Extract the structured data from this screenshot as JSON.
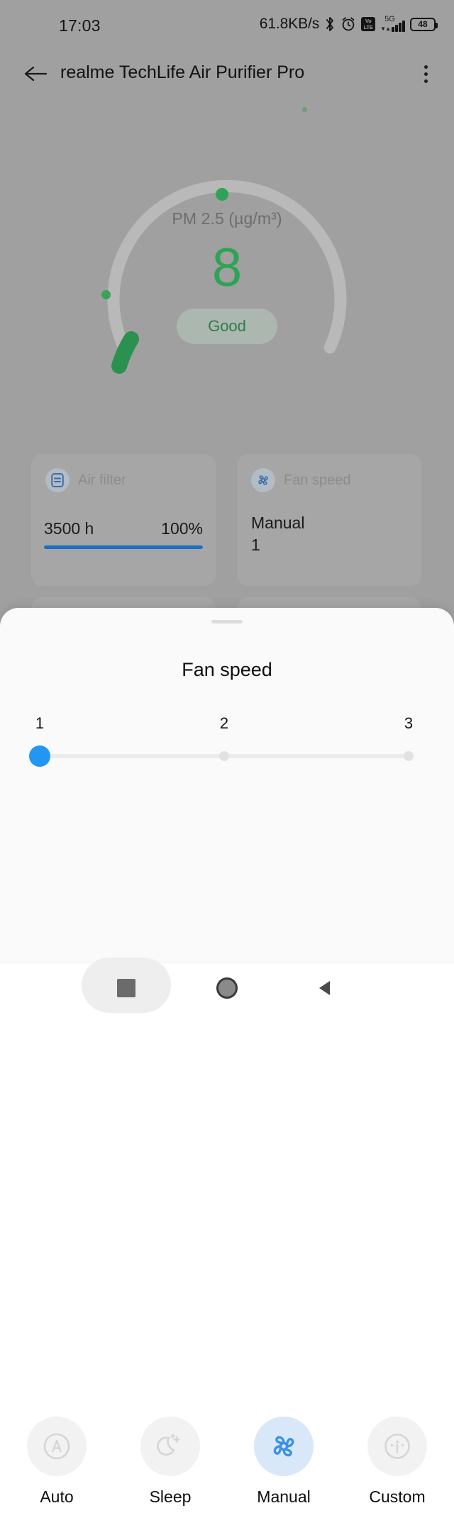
{
  "status_bar": {
    "clock": "17:03",
    "network_speed": "61.8KB/s",
    "bluetooth_icon": "bluetooth-icon",
    "alarm_icon": "alarm-clock-icon",
    "volte_line1": "Vo",
    "volte_line2": "LTE",
    "network_type": "5G",
    "battery_level": "48"
  },
  "title_bar": {
    "back_icon": "back-arrow-icon",
    "title": "realme TechLife Air Purifier Pro",
    "menu_icon": "overflow-menu-icon"
  },
  "gauge": {
    "metric_label": "PM 2.5 (µg/m³)",
    "value": "8",
    "quality_badge": "Good",
    "arc_color": "#2fa355",
    "track_color": "#b8b8b8",
    "value_color": "#2fa355"
  },
  "cards": [
    {
      "name": "air-filter",
      "icon": "filter-document-icon",
      "title": "Air filter",
      "hours": "3500 h",
      "percent": "100%",
      "progress": 100,
      "progress_color": "#1a6fc4"
    },
    {
      "name": "fan-speed",
      "icon": "fan-icon",
      "title": "Fan speed",
      "mode": "Manual",
      "level": "1"
    }
  ],
  "bottom_sheet": {
    "title": "Fan speed",
    "slider": {
      "tick_labels": [
        "1",
        "2",
        "3"
      ],
      "value": 1,
      "min": 1,
      "max": 3,
      "thumb_color": "#2196f3",
      "track_color": "#ececec"
    },
    "modes": [
      {
        "icon": "auto-a-circle-icon",
        "label": "Auto",
        "selected": false
      },
      {
        "icon": "moon-sleep-icon",
        "label": "Sleep",
        "selected": false
      },
      {
        "icon": "fan-icon",
        "label": "Manual",
        "selected": true
      },
      {
        "icon": "gauge-custom-icon",
        "label": "Custom",
        "selected": false
      }
    ],
    "selected_color": "#d9e8f8",
    "selected_icon_color": "#3c90e8"
  },
  "nav_bar": {
    "recents_icon": "recents-square-icon",
    "home_icon": "home-circle-icon",
    "back_icon": "nav-back-triangle-icon"
  }
}
